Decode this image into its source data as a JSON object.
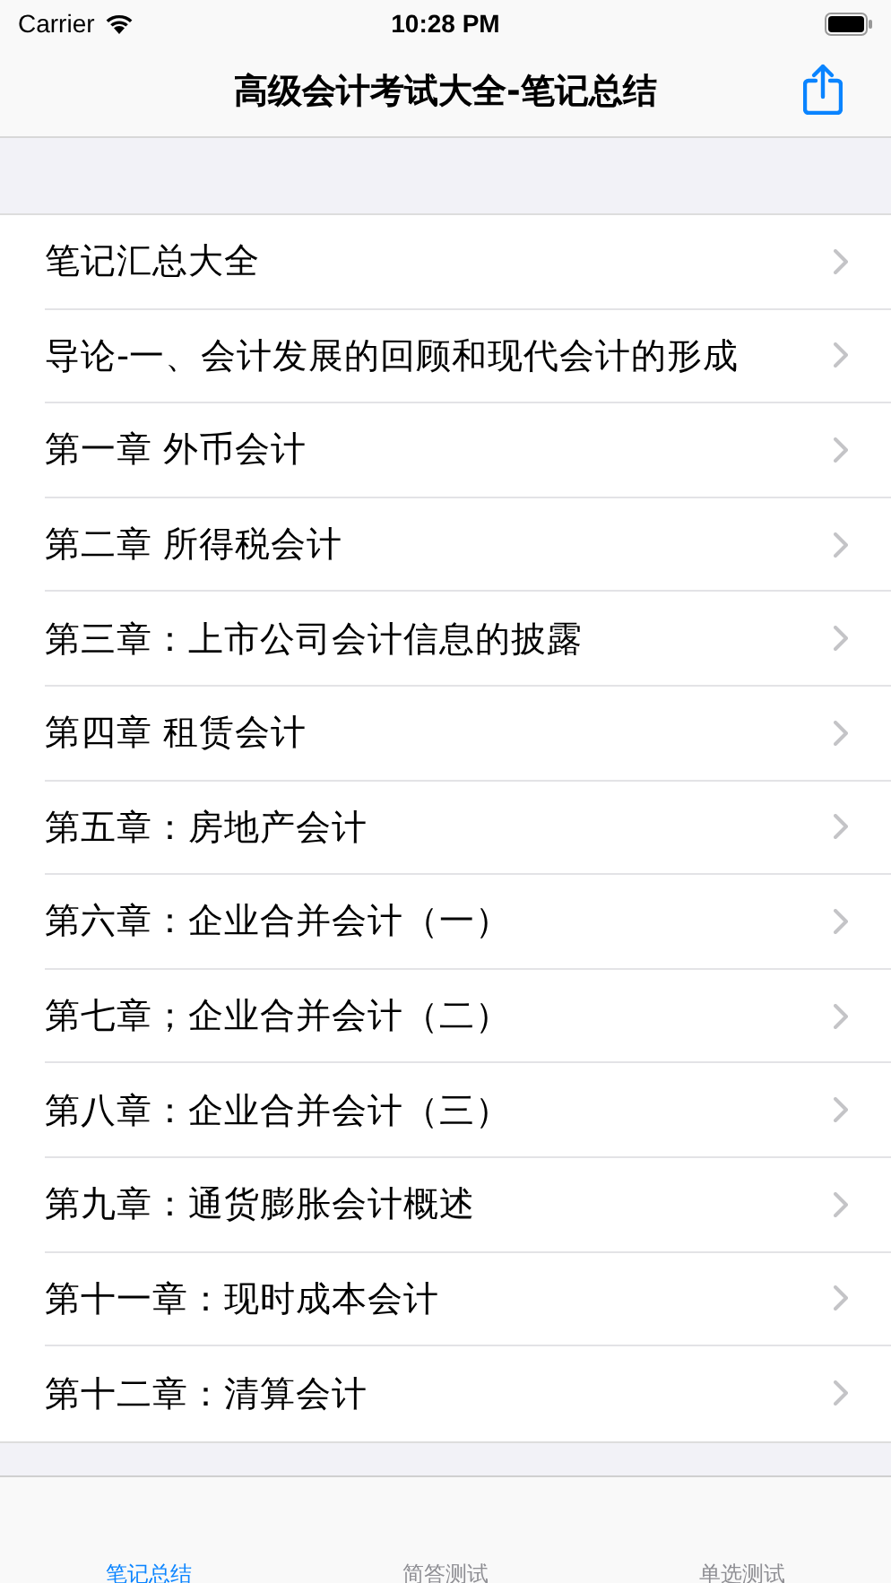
{
  "status_bar": {
    "carrier": "Carrier",
    "time": "10:28 PM"
  },
  "nav_bar": {
    "title": "高级会计考试大全-笔记总结"
  },
  "list": [
    {
      "label": "笔记汇总大全"
    },
    {
      "label": "导论-一、会计发展的回顾和现代会计的形成"
    },
    {
      "label": "第一章  外币会计"
    },
    {
      "label": "第二章  所得税会计"
    },
    {
      "label": "第三章：上市公司会计信息的披露"
    },
    {
      "label": "第四章 租赁会计"
    },
    {
      "label": "第五章：房地产会计"
    },
    {
      "label": "第六章：企业合并会计（一）"
    },
    {
      "label": "第七章；企业合并会计（二）"
    },
    {
      "label": "第八章：企业合并会计（三）"
    },
    {
      "label": "第九章：通货膨胀会计概述"
    },
    {
      "label": "第十一章：现时成本会计"
    },
    {
      "label": "第十二章：清算会计"
    }
  ],
  "tab_bar": [
    {
      "label": "笔记总结",
      "selected": true
    },
    {
      "label": "简答测试",
      "selected": false
    },
    {
      "label": "单选测试",
      "selected": false
    }
  ]
}
